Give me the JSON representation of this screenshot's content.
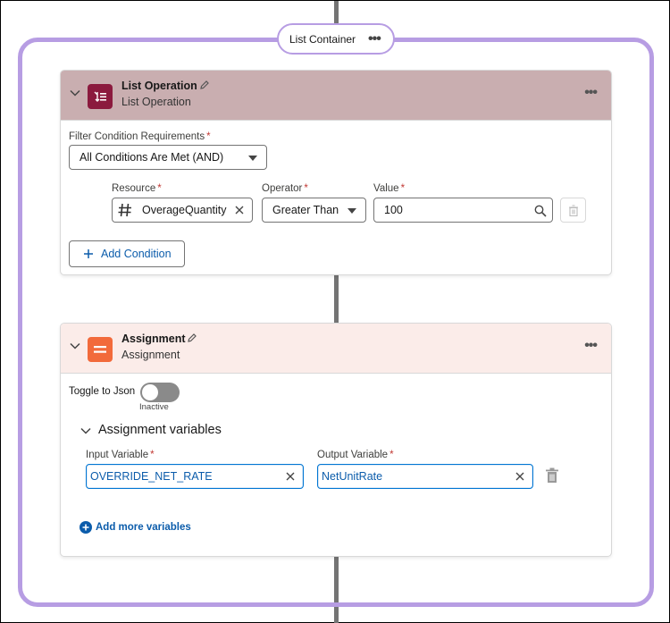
{
  "container": {
    "label": "List Container",
    "more_label": "•••"
  },
  "list_operation": {
    "title": "List Operation",
    "subtitle": "List Operation",
    "more_label": "•••",
    "filter_label": "Filter Condition Requirements",
    "filter_value": "All Conditions Are Met (AND)",
    "resource_label": "Resource",
    "resource_value": "OverageQuantity",
    "operator_label": "Operator",
    "operator_value": "Greater Than",
    "value_label": "Value",
    "value_value": "100",
    "add_condition_label": "Add Condition",
    "header_color": "#c9aeb0",
    "icon_color": "#8b1a3e"
  },
  "assignment": {
    "title": "Assignment",
    "subtitle": "Assignment",
    "more_label": "•••",
    "toggle_label": "Toggle to Json",
    "toggle_state": "Inactive",
    "section_label": "Assignment variables",
    "input_label": "Input Variable",
    "input_value": "OVERRIDE_NET_RATE",
    "output_label": "Output Variable",
    "output_value": "NetUnitRate",
    "add_more_label": "Add more variables",
    "header_color": "#fbece9",
    "icon_color": "#f26a3b"
  },
  "required_marker": "*"
}
